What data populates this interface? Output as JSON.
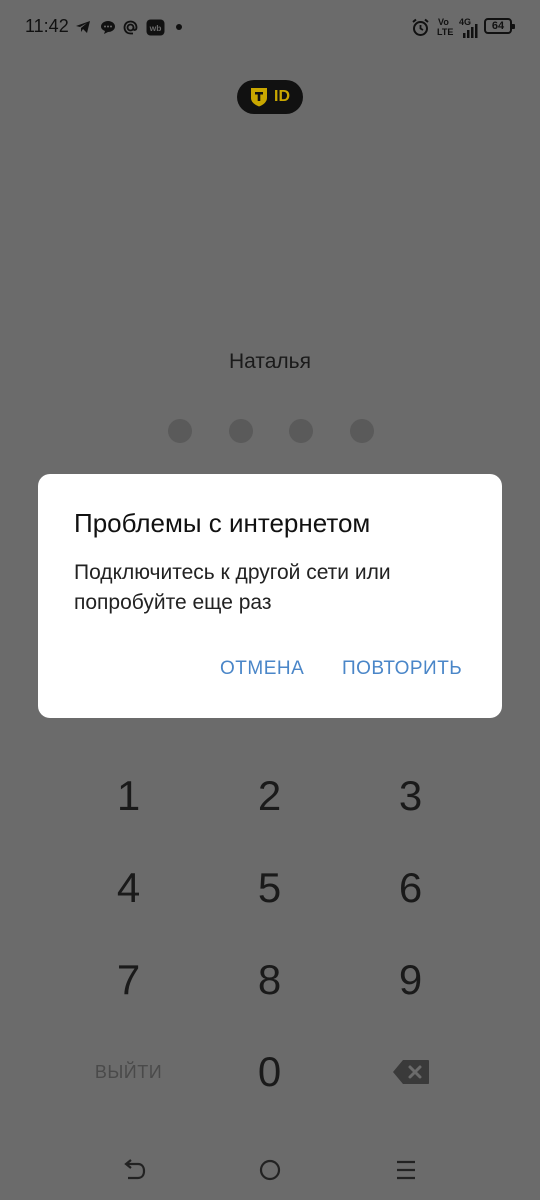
{
  "status_bar": {
    "time": "11:42",
    "volte_top": "Vo",
    "volte_bottom": "LTE",
    "network": "4G",
    "battery": "64"
  },
  "logo": {
    "text": "ID",
    "accent_color": "#c9a700"
  },
  "user": {
    "name": "Наталья"
  },
  "pin": {
    "length": 4
  },
  "dialog": {
    "title": "Проблемы с интернетом",
    "message": "Подключитесь к другой сети или попробуйте еще раз",
    "cancel_label": "ОТМЕНА",
    "retry_label": "ПОВТОРИТЬ",
    "button_color": "#4a86c8"
  },
  "keypad": {
    "keys": [
      "1",
      "2",
      "3",
      "4",
      "5",
      "6",
      "7",
      "8",
      "9"
    ],
    "zero": "0",
    "logout_label": "ВЫЙТИ"
  },
  "icons": {
    "status": [
      "telegram-icon",
      "chat-icon",
      "at-icon",
      "wb-icon",
      "dot-icon",
      "alarm-icon",
      "signal-icon"
    ],
    "backspace": "backspace-icon",
    "nav": [
      "back-icon",
      "home-icon",
      "menu-icon"
    ]
  }
}
